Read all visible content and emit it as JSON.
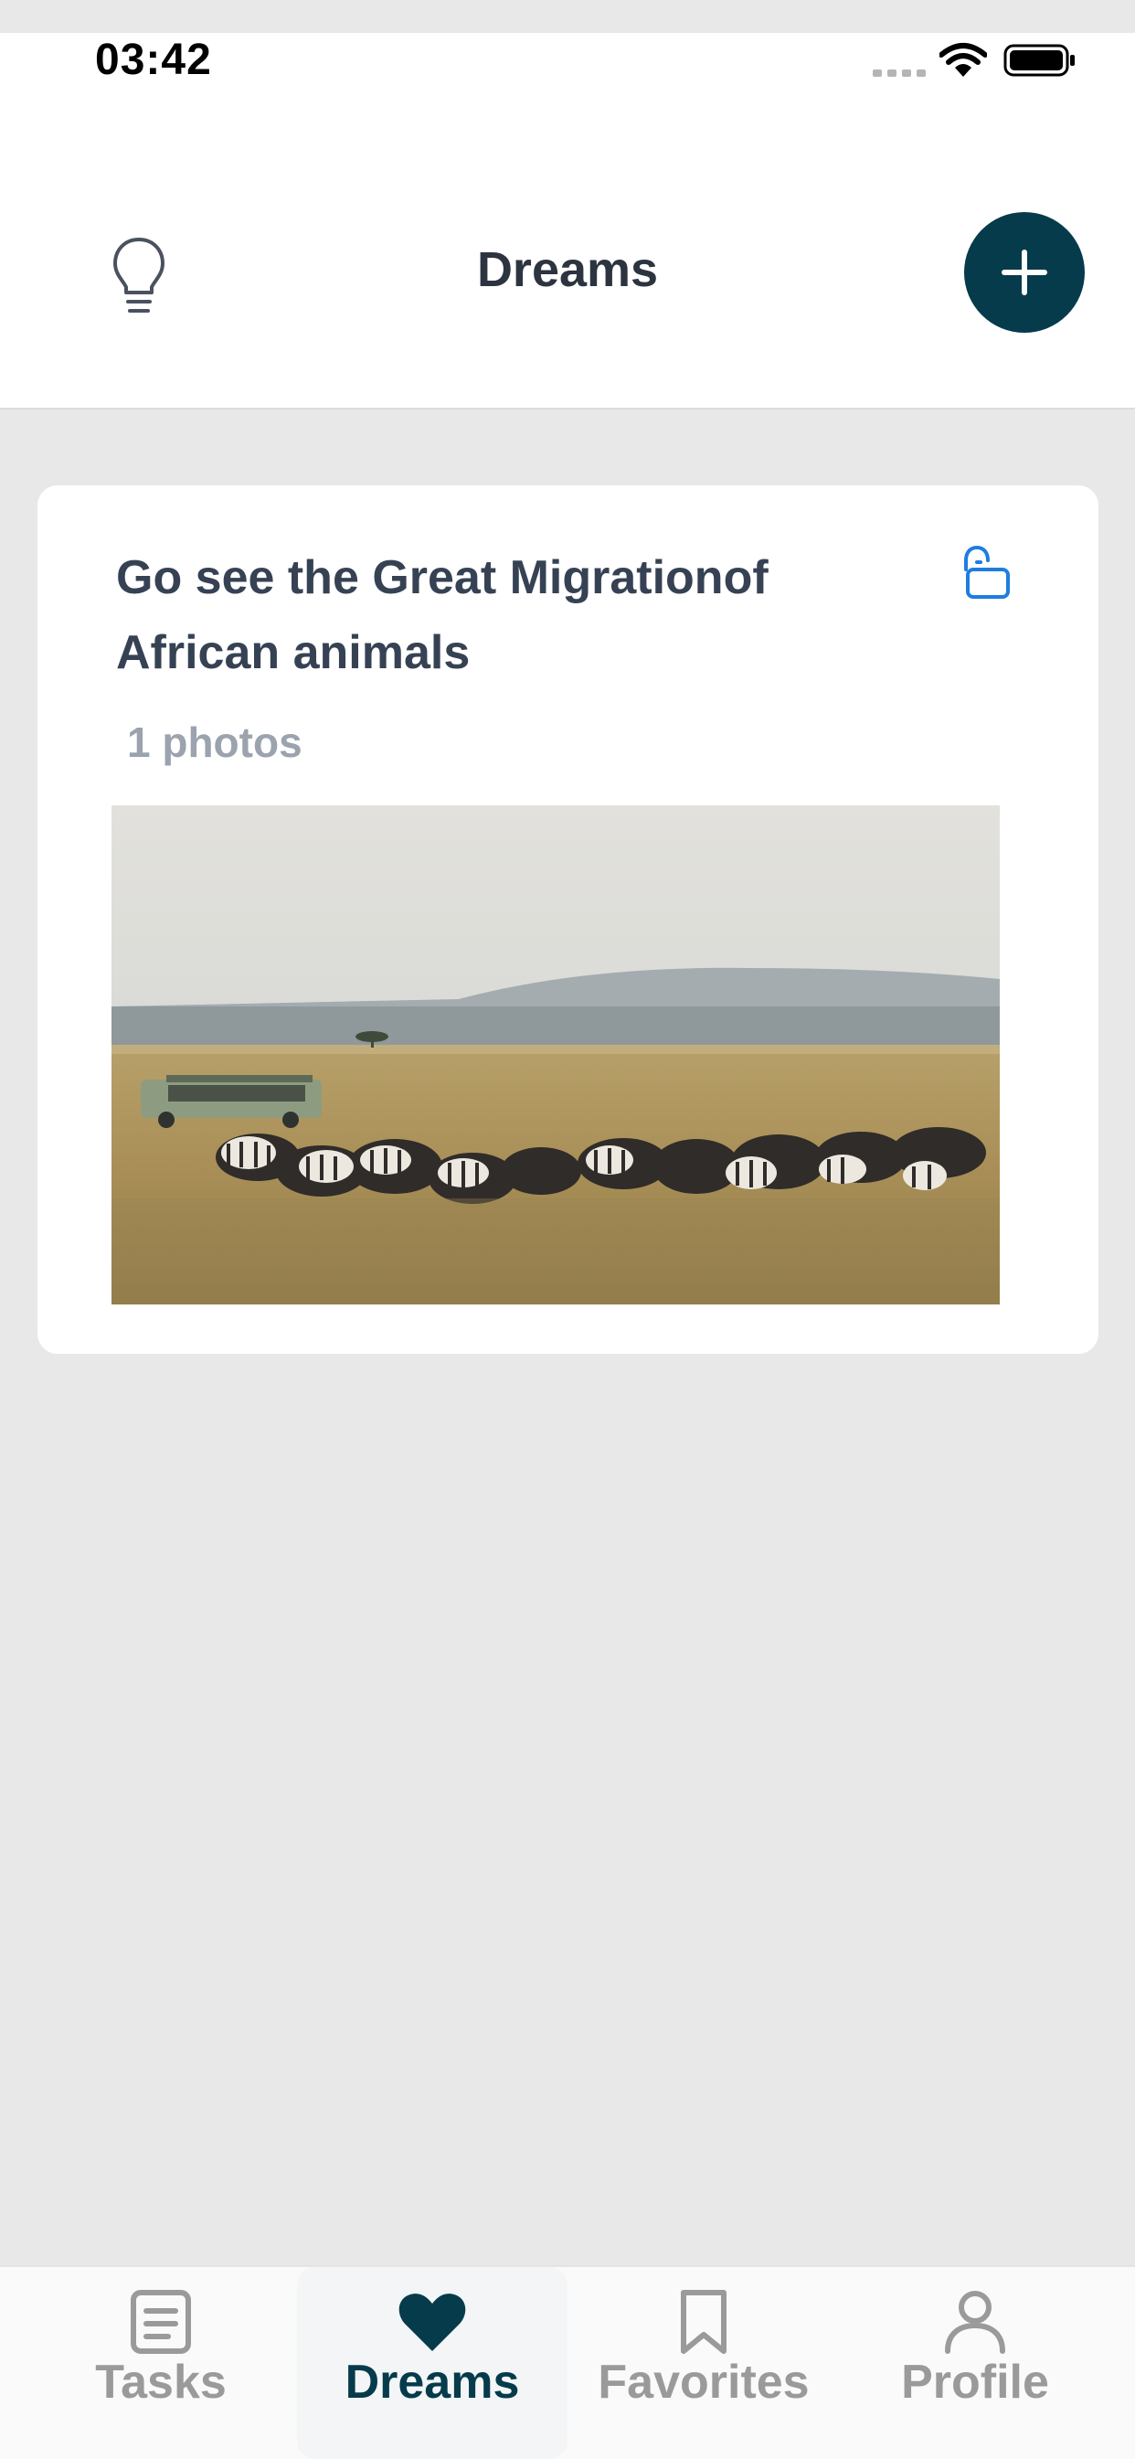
{
  "status_bar": {
    "time": "03:42",
    "icons": [
      "signal-icon",
      "wifi-icon",
      "battery-icon"
    ]
  },
  "header": {
    "title": "Dreams",
    "left_icon": "lightbulb-icon",
    "right_icon": "plus-icon"
  },
  "dreams": [
    {
      "title": "Go see the Great Migrationof African animals",
      "photo_count": "1 photos",
      "lock_icon": "unlock-icon",
      "photo": "savanna-zebra-wildebeest-photo"
    }
  ],
  "tabbar": {
    "items": [
      {
        "label": "Tasks",
        "icon": "task-list-icon",
        "active": false
      },
      {
        "label": "Dreams",
        "icon": "heart-icon",
        "active": true
      },
      {
        "label": "Favorites",
        "icon": "bookmark-icon",
        "active": false
      },
      {
        "label": "Profile",
        "icon": "person-icon",
        "active": false
      }
    ]
  },
  "colors": {
    "accent": "#053b4b",
    "background": "#e8e8e8",
    "card": "#ffffff",
    "muted_text": "#9aa3ae",
    "inactive_tab": "#9a9a9a",
    "lock_icon": "#1e7de0"
  }
}
